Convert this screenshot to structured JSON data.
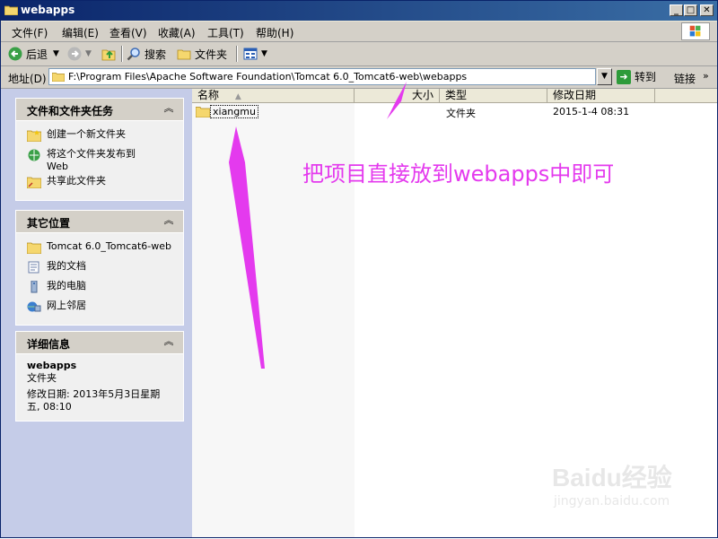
{
  "window": {
    "title": "webapps"
  },
  "menu": [
    "文件(F)",
    "编辑(E)",
    "查看(V)",
    "收藏(A)",
    "工具(T)",
    "帮助(H)"
  ],
  "toolbar": {
    "back": "后退",
    "search": "搜索",
    "folders": "文件夹"
  },
  "address": {
    "label": "地址(D)",
    "path": "F:\\Program Files\\Apache Software Foundation\\Tomcat 6.0_Tomcat6-web\\webapps",
    "go": "转到",
    "links": "链接"
  },
  "panels": {
    "tasks": {
      "title": "文件和文件夹任务",
      "items": [
        "创建一个新文件夹",
        "将这个文件夹发布到",
        "Web",
        "共享此文件夹"
      ]
    },
    "places": {
      "title": "其它位置",
      "items": [
        "Tomcat 6.0_Tomcat6-web",
        "我的文档",
        "我的电脑",
        "网上邻居"
      ]
    },
    "details": {
      "title": "详细信息",
      "name": "webapps",
      "type": "文件夹",
      "modified_1": "修改日期: 2013年5月3日星期",
      "modified_2": "五, 08:10"
    }
  },
  "columns": {
    "name": "名称",
    "size": "大小",
    "type": "类型",
    "modified": "修改日期"
  },
  "files": [
    {
      "name": "xiangmu",
      "size": "",
      "type": "文件夹",
      "modified": "2015-1-4 08:31"
    }
  ],
  "annotation": "把项目直接放到webapps中即可",
  "watermark": {
    "brand": "Baidu经验",
    "url": "jingyan.baidu.com"
  },
  "colors": {
    "annotation": "#e43aee",
    "titlebar": "#0a246a"
  }
}
